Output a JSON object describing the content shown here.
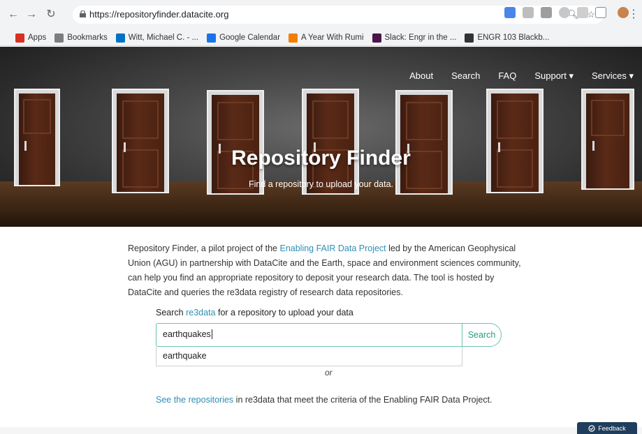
{
  "browser": {
    "url": "https://repositoryfinder.datacite.org",
    "bookmarks": [
      {
        "label": "Apps",
        "icon": "apps-grid-icon",
        "color": "#d93025"
      },
      {
        "label": "Bookmarks",
        "icon": "folder-icon",
        "color": "#5f6368"
      },
      {
        "label": "Witt, Michael C. - ...",
        "icon": "outlook-icon",
        "color": "#0072c6"
      },
      {
        "label": "Google Calendar",
        "icon": "calendar-icon",
        "color": "#1a73e8"
      },
      {
        "label": "A Year With Rumi",
        "icon": "blogger-icon",
        "color": "#f57d00"
      },
      {
        "label": "Slack: Engr in the ...",
        "icon": "slack-icon",
        "color": "#4a154b"
      },
      {
        "label": "ENGR 103 Blackb...",
        "icon": "blackboard-icon",
        "color": "#333333"
      }
    ]
  },
  "nav": {
    "about": "About",
    "search": "Search",
    "faq": "FAQ",
    "support": "Support ▾",
    "services": "Services ▾"
  },
  "hero": {
    "title": "Repository Finder",
    "subtitle": "Find a repository to upload your data."
  },
  "intro": {
    "text1": "Repository Finder, a pilot project of the ",
    "link1": "Enabling FAIR Data Project",
    "text2": " led by the American Geophysical Union (AGU) in partnership with DataCite and the Earth, space and environment sciences community, can help you find an appropriate repository to deposit your research data. The tool is hosted by DataCite and queries the re3data registry of research data repositories."
  },
  "search": {
    "label_prefix": "Search ",
    "label_link": "re3data",
    "label_suffix": " for a repository to upload your data",
    "value": "earthquakes",
    "button": "Search",
    "suggestion": "earthquake",
    "or": "or"
  },
  "see_repos": {
    "link": "See the repositories",
    "text": " in re3data that meet the criteria of the Enabling FAIR Data Project."
  },
  "feedback": "Feedback",
  "colors": {
    "link": "#2f8fb5",
    "accent": "#2a9a82",
    "feedback_bg": "#1f3d5c"
  }
}
